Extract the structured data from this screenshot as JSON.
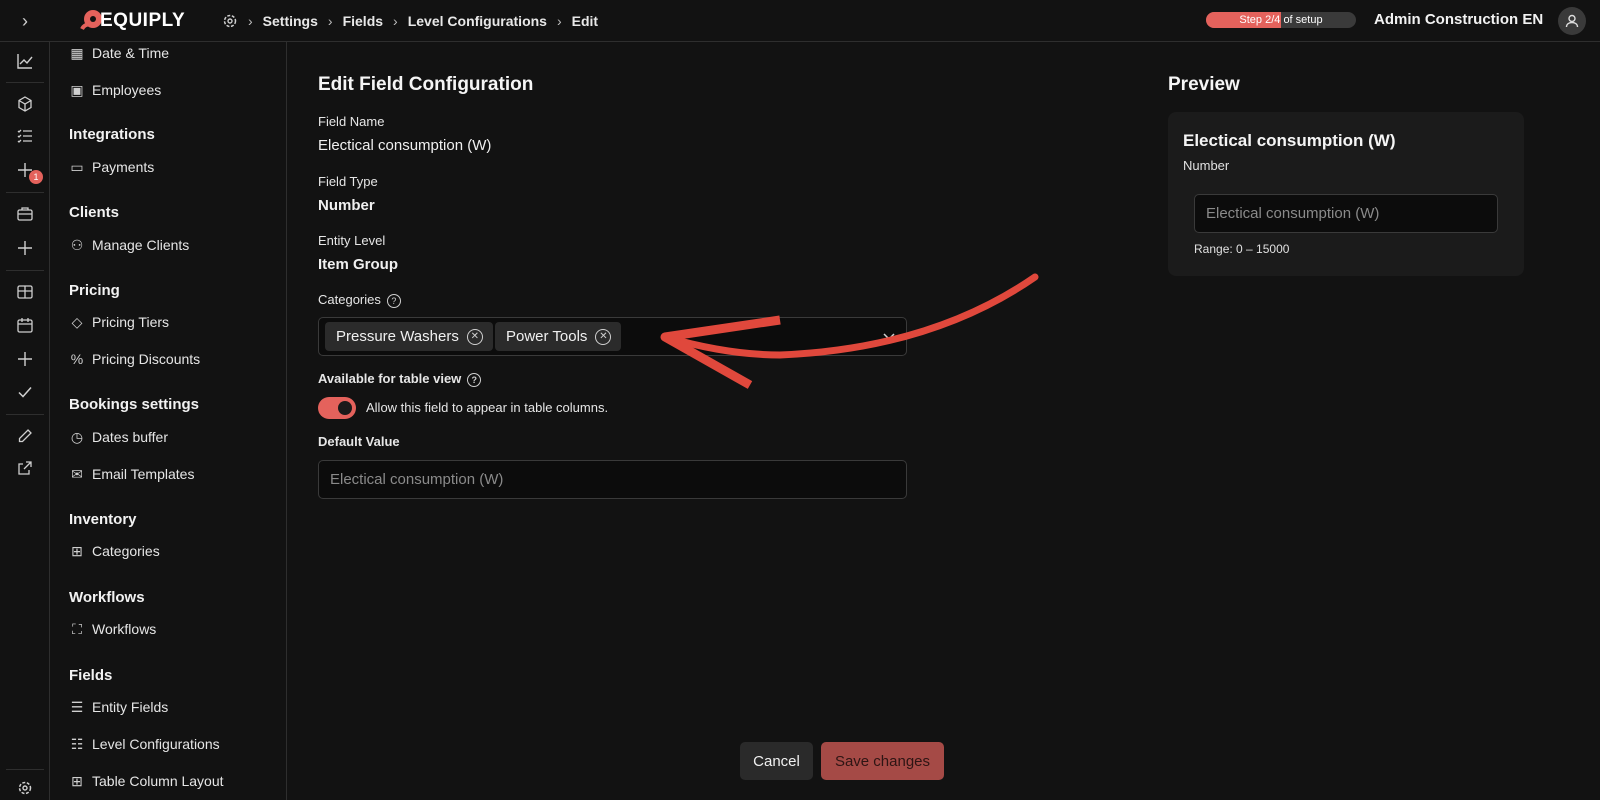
{
  "brand": {
    "name": "EQUIPLY",
    "accent": "#e4625c"
  },
  "breadcrumb": [
    "Settings",
    "Fields",
    "Level Configurations",
    "Edit"
  ],
  "setup": {
    "label": "Step 2/4 of setup",
    "progress_fraction": 0.5
  },
  "user": {
    "name": "Admin Construction EN"
  },
  "rail": {
    "badge_count": "1"
  },
  "nav": {
    "date_time": "Date & Time",
    "employees": "Employees",
    "integrations": "Integrations",
    "payments": "Payments",
    "clients": "Clients",
    "manage_clients": "Manage Clients",
    "pricing": "Pricing",
    "pricing_tiers": "Pricing Tiers",
    "pricing_discounts": "Pricing Discounts",
    "bookings_settings": "Bookings settings",
    "dates_buffer": "Dates buffer",
    "email_templates": "Email Templates",
    "inventory": "Inventory",
    "categories": "Categories",
    "workflows_section": "Workflows",
    "workflows": "Workflows",
    "fields": "Fields",
    "entity_fields": "Entity Fields",
    "level_configurations": "Level Configurations",
    "table_column_layout": "Table Column Layout"
  },
  "form": {
    "title": "Edit Field Configuration",
    "field_name_label": "Field Name",
    "field_name_value": "Electical consumption (W)",
    "field_type_label": "Field Type",
    "field_type_value": "Number",
    "entity_level_label": "Entity Level",
    "entity_level_value": "Item Group",
    "categories_label": "Categories",
    "categories_selected": [
      "Pressure Washers",
      "Power Tools"
    ],
    "table_view_label": "Available for table view",
    "table_view_enabled": true,
    "table_view_text": "Allow this field to appear in table columns.",
    "default_value_label": "Default Value",
    "default_value_placeholder": "Electical consumption (W)"
  },
  "preview": {
    "heading": "Preview",
    "title": "Electical consumption (W)",
    "type": "Number",
    "placeholder": "Electical consumption (W)",
    "range": "Range: 0 – 15000"
  },
  "actions": {
    "cancel": "Cancel",
    "save": "Save changes"
  }
}
